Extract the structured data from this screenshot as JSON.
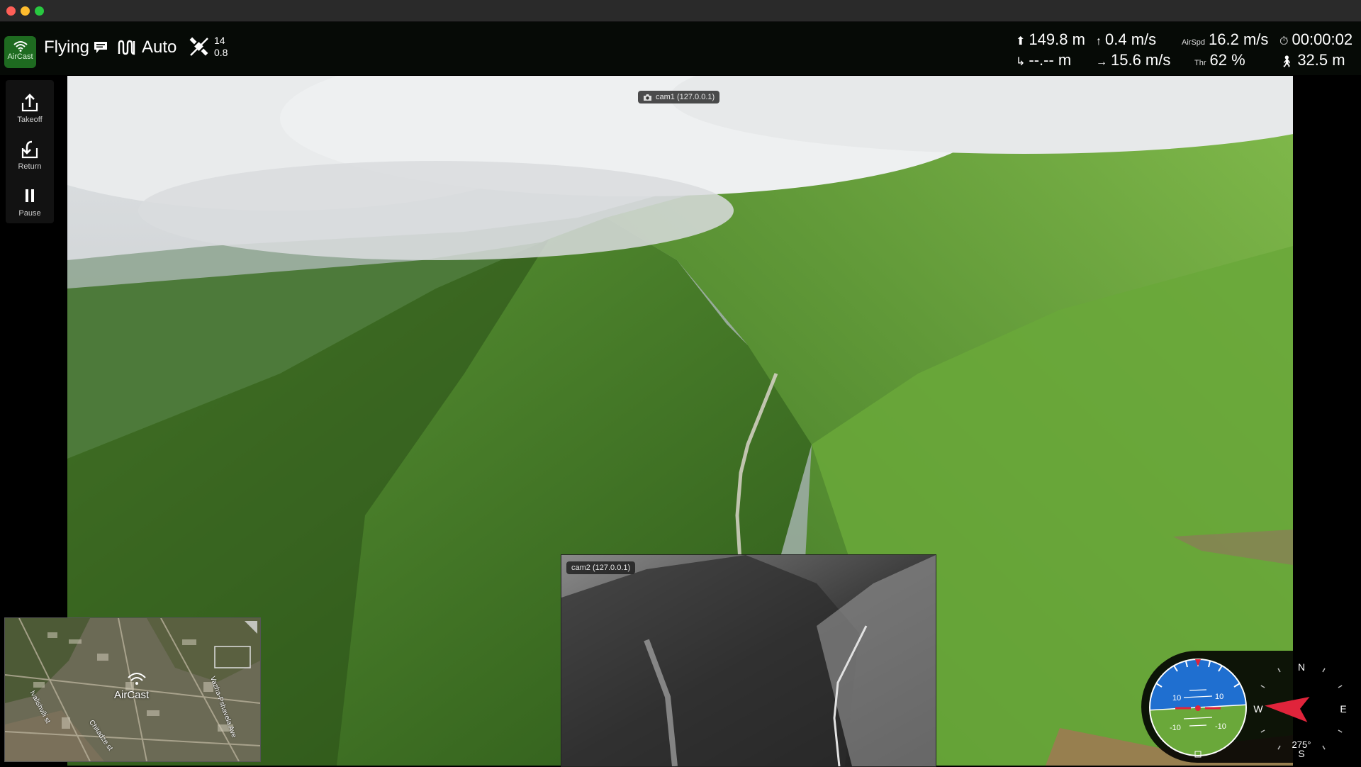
{
  "window": {
    "traffic_lights": [
      "close",
      "minimize",
      "zoom"
    ]
  },
  "topbar": {
    "brand_label": "AirCast",
    "flight_status": "Flying",
    "flight_mode": "Auto",
    "gps_satellites": "14",
    "gps_hdop": "0.8",
    "telemetry": {
      "altitude": "149.8 m",
      "vertical_speed": "0.4 m/s",
      "airspeed_label": "AirSpd",
      "airspeed": "16.2 m/s",
      "flight_time": "00:00:02",
      "distance_to_home": "--.-- m",
      "ground_speed": "15.6 m/s",
      "throttle_label": "Thr",
      "throttle": "62 %",
      "distance_walked": "32.5 m"
    }
  },
  "sidebar": {
    "items": [
      {
        "label": "Takeoff",
        "icon": "takeoff-icon"
      },
      {
        "label": "Return",
        "icon": "return-icon"
      },
      {
        "label": "Pause",
        "icon": "pause-icon"
      }
    ]
  },
  "video": {
    "cam1_label": "cam1 (127.0.0.1)",
    "cam2_label": "cam2 (127.0.0.1)"
  },
  "minimap": {
    "label": "AirCast",
    "streets": [
      "Ivalishvili st",
      "Chitadze st",
      "Vazha-Pshavela Ave"
    ]
  },
  "instruments": {
    "pitch_marks": [
      "10",
      "10",
      "-10",
      "-10"
    ],
    "compass": {
      "n": "N",
      "s": "S",
      "e": "E",
      "w": "W",
      "heading": "275°"
    },
    "heading_deg": 275
  },
  "colors": {
    "brand_green": "#1e6b20",
    "sky_blue": "#1f6fd0",
    "ground_green": "#6aa83a",
    "heading_red": "#e0243b"
  }
}
